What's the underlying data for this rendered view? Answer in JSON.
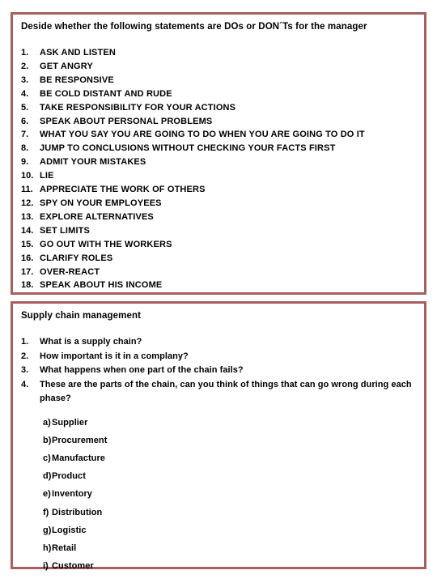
{
  "theme": {
    "border_color": "#a85f5f",
    "background_color": "#ffffff",
    "text_color": "#000000"
  },
  "box_1": {
    "heading": "Deside whether the following statements are DOs or DON´Ts for the manager",
    "items": [
      {
        "num": "1.",
        "text": "ASK AND LISTEN"
      },
      {
        "num": "2.",
        "text": "GET ANGRY"
      },
      {
        "num": "3.",
        "text": "BE RESPONSIVE"
      },
      {
        "num": "4.",
        "text": "BE COLD DISTANT AND RUDE"
      },
      {
        "num": "5.",
        "text": "TAKE RESPONSIBILITY FOR YOUR ACTIONS"
      },
      {
        "num": "6.",
        "text": "SPEAK ABOUT PERSONAL PROBLEMS"
      },
      {
        "num": "7.",
        "text": "WHAT YOU SAY YOU ARE GOING TO DO WHEN YOU ARE GOING TO DO IT"
      },
      {
        "num": "8.",
        "text": "JUMP TO CONCLUSIONS WITHOUT CHECKING YOUR FACTS FIRST"
      },
      {
        "num": "9.",
        "text": "ADMIT YOUR MISTAKES"
      },
      {
        "num": "10.",
        "text": "LIE"
      },
      {
        "num": "11.",
        "text": "APPRECIATE THE WORK OF OTHERS"
      },
      {
        "num": "12.",
        "text": "SPY ON YOUR EMPLOYEES"
      },
      {
        "num": "13.",
        "text": "EXPLORE ALTERNATIVES"
      },
      {
        "num": "14.",
        "text": "SET LIMITS"
      },
      {
        "num": "15.",
        "text": "GO OUT WITH THE WORKERS"
      },
      {
        "num": "16.",
        "text": "CLARIFY ROLES"
      },
      {
        "num": "17.",
        "text": "OVER-REACT"
      },
      {
        "num": "18.",
        "text": "SPEAK ABOUT HIS INCOME"
      }
    ]
  },
  "box_2": {
    "heading": "Supply chain management",
    "items": [
      {
        "num": "1.",
        "text": "What is a supply chain?"
      },
      {
        "num": "2.",
        "text": "How important is it in a complany?"
      },
      {
        "num": "3.",
        "text": "What happens when one part of the chain fails?"
      },
      {
        "num": "4.",
        "text": "These are the parts of the chain, can you think of things that can go wrong during each phase?"
      }
    ],
    "sub_items": [
      {
        "letter": "a)",
        "text": "Supplier"
      },
      {
        "letter": "b)",
        "text": "Procurement"
      },
      {
        "letter": "c)",
        "text": "Manufacture"
      },
      {
        "letter": "d)",
        "text": "Product"
      },
      {
        "letter": "e)",
        "text": "Inventory"
      },
      {
        "letter": "f)",
        "text": "Distribution"
      },
      {
        "letter": "g)",
        "text": "Logistic"
      },
      {
        "letter": "h)",
        "text": "Retail"
      },
      {
        "letter": "i)",
        "text": "Customer"
      }
    ]
  }
}
